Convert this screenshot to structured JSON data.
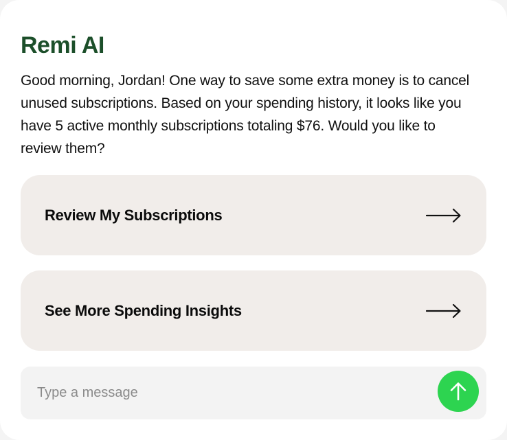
{
  "header": {
    "title": "Remi AI"
  },
  "message": {
    "text": "Good morning, Jordan! One way to save some extra money is to cancel unused subscriptions. Based on your spending history, it looks like you have 5 active monthly subscriptions totaling $76. Would you like to review them?"
  },
  "actions": [
    {
      "label": "Review My Subscriptions",
      "icon": "arrow-right-icon"
    },
    {
      "label": "See More Spending Insights",
      "icon": "arrow-right-icon"
    }
  ],
  "composer": {
    "placeholder": "Type a message",
    "value": "",
    "send_icon": "arrow-up-icon"
  },
  "colors": {
    "brand": "#1c4f2a",
    "action_background": "#f1edea",
    "send_button": "#2dd450"
  }
}
